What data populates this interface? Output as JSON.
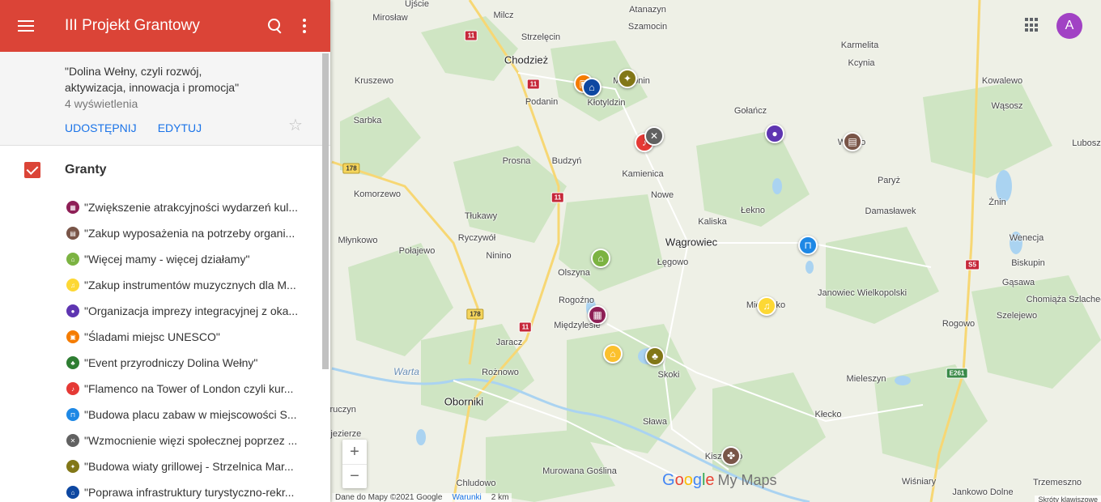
{
  "header": {
    "title": "III Projekt Grantowy"
  },
  "info": {
    "description": "\"Dolina Wełny, czyli rozwój, aktywizacja, innowacja i promocja\"",
    "views": "4 wyświetlenia",
    "share_label": "UDOSTĘPNIJ",
    "edit_label": "EDYTUJ"
  },
  "layer": {
    "title": "Granty"
  },
  "items": [
    {
      "label": "\"Zwiększenie atrakcyjności wydarzeń kul...",
      "color": "#8e1f56",
      "icon": "cart-icon"
    },
    {
      "label": "\"Zakup wyposażenia na potrzeby organi...",
      "color": "#795548",
      "icon": "box-icon"
    },
    {
      "label": "\"Więcej mamy - więcej działamy\"",
      "color": "#7cb342",
      "icon": "home-icon"
    },
    {
      "label": "\"Zakup instrumentów muzycznych dla M...",
      "color": "#fdd835",
      "icon": "music-icon"
    },
    {
      "label": "\"Organizacja imprezy integracyjnej z oka...",
      "color": "#5e35b1",
      "icon": "stroller-icon"
    },
    {
      "label": "\"Śladami miejsc UNESCO\"",
      "color": "#f57c00",
      "icon": "bus-icon"
    },
    {
      "label": "\"Event przyrodniczy Dolina Wełny\"",
      "color": "#2e7d32",
      "icon": "tree-icon"
    },
    {
      "label": "\"Flamenco na Tower of London czyli kur...",
      "color": "#e53935",
      "icon": "dance-icon"
    },
    {
      "label": "\"Budowa placu zabaw w miejscowości S...",
      "color": "#1e88e5",
      "icon": "swing-icon"
    },
    {
      "label": "\"Wzmocnienie więzi społecznej poprzez ...",
      "color": "#616161",
      "icon": "tools-icon"
    },
    {
      "label": "\"Budowa wiaty grillowej - Strzelnica Mar...",
      "color": "#827717",
      "icon": "grill-icon"
    },
    {
      "label": "\"Poprawa infrastruktury turystyczno-rekr...",
      "color": "#0d47a1",
      "icon": "house-icon"
    }
  ],
  "map": {
    "places": [
      {
        "name": "Ujście",
        "big": false
      },
      {
        "name": "Mirosław",
        "big": false
      },
      {
        "name": "Milcz",
        "big": false
      },
      {
        "name": "Atanazyn",
        "big": false
      },
      {
        "name": "Szamocin",
        "big": false
      },
      {
        "name": "Strzelęcin",
        "big": false
      },
      {
        "name": "Chodzież",
        "big": true
      },
      {
        "name": "Karmelita",
        "big": false
      },
      {
        "name": "Kcynia",
        "big": false
      },
      {
        "name": "Kruszewo",
        "big": false
      },
      {
        "name": "Podanin",
        "big": false
      },
      {
        "name": "Kłotyldzin",
        "big": false
      },
      {
        "name": "Margonin",
        "big": false
      },
      {
        "name": "Kowalewo",
        "big": false
      },
      {
        "name": "Wąsosz",
        "big": false
      },
      {
        "name": "Sarbka",
        "big": false
      },
      {
        "name": "Gołańcz",
        "big": false
      },
      {
        "name": "Lubosz",
        "big": false
      },
      {
        "name": "Wapno",
        "big": false
      },
      {
        "name": "Prosna",
        "big": false
      },
      {
        "name": "Budzyń",
        "big": false
      },
      {
        "name": "Kamienica",
        "big": false
      },
      {
        "name": "Paryż",
        "big": false
      },
      {
        "name": "Komorzewo",
        "big": false
      },
      {
        "name": "Nowe",
        "big": false
      },
      {
        "name": "Żnin",
        "big": false
      },
      {
        "name": "Łekno",
        "big": false
      },
      {
        "name": "Damasławek",
        "big": false
      },
      {
        "name": "Tłukawy",
        "big": false
      },
      {
        "name": "Kaliska",
        "big": false
      },
      {
        "name": "Ryczywół",
        "big": false
      },
      {
        "name": "Młynkowo",
        "big": false
      },
      {
        "name": "Wągrowiec",
        "big": true
      },
      {
        "name": "Wenecja",
        "big": false
      },
      {
        "name": "Połajewo",
        "big": false
      },
      {
        "name": "Biskupin",
        "big": false
      },
      {
        "name": "Ninino",
        "big": false
      },
      {
        "name": "Łęgowo",
        "big": false
      },
      {
        "name": "Olszyna",
        "big": false
      },
      {
        "name": "Gąsawa",
        "big": false
      },
      {
        "name": "Janowiec Wielkopolski",
        "big": false
      },
      {
        "name": "Chomiąża Szlachecka",
        "big": false
      },
      {
        "name": "Rogoźno",
        "big": false
      },
      {
        "name": "Mieścisko",
        "big": false
      },
      {
        "name": "Szelejewo",
        "big": false
      },
      {
        "name": "Międzylesie",
        "big": false
      },
      {
        "name": "Rogowo",
        "big": false
      },
      {
        "name": "Jaracz",
        "big": false
      },
      {
        "name": "Rożnowo",
        "big": false
      },
      {
        "name": "Skoki",
        "big": false
      },
      {
        "name": "Mieleszyn",
        "big": false
      },
      {
        "name": "Oborniki",
        "big": true
      },
      {
        "name": "Kłecko",
        "big": false
      },
      {
        "name": "Sława",
        "big": false
      },
      {
        "name": "Kiszkowo",
        "big": false
      },
      {
        "name": "Murowana Goślina",
        "big": false
      },
      {
        "name": "Chludowo",
        "big": false
      },
      {
        "name": "Wiśniary",
        "big": false
      },
      {
        "name": "Jankowo Dolne",
        "big": false
      },
      {
        "name": "Trzemeszno",
        "big": false
      },
      {
        "name": "Kruczyn",
        "big": false
      },
      {
        "name": "Objezierze",
        "big": false
      }
    ],
    "river": "Warta",
    "shields": [
      "11",
      "11",
      "11",
      "11",
      "178",
      "178",
      "11",
      "S5",
      "E261"
    ],
    "zoom_in": "+",
    "zoom_out": "−",
    "attribution": "Dane do Mapy ©2021 Google",
    "terms": "Warunki",
    "scale": "2 km",
    "shortcuts": "Skróty klawiszowe",
    "avatar_letter": "A",
    "logo": {
      "g1": "G",
      "g2": "o",
      "g3": "o",
      "g4": "g",
      "g5": "l",
      "g6": "e",
      "my_maps": "My Maps"
    }
  }
}
